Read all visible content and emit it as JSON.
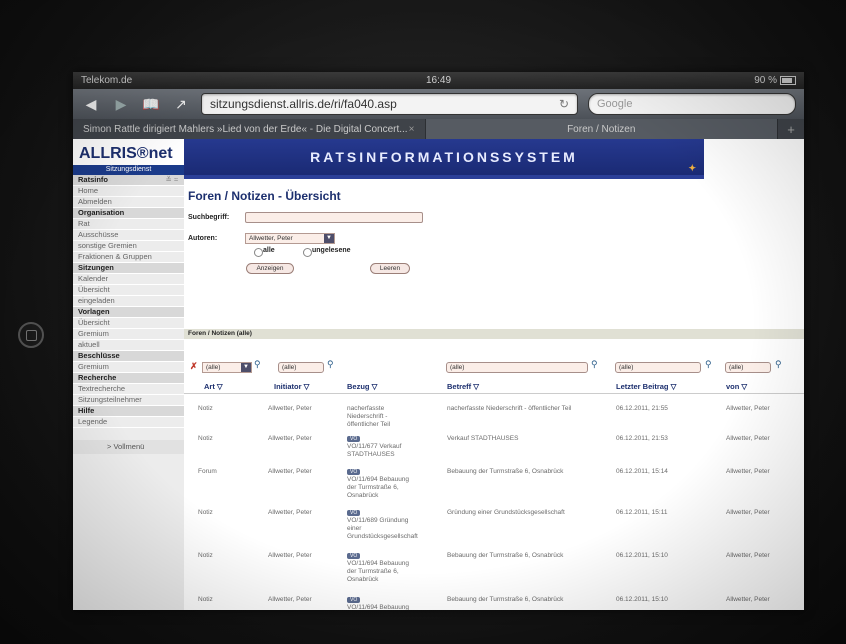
{
  "statusbar": {
    "carrier": "Telekom.de",
    "time": "16:49",
    "battery": "90 %"
  },
  "browser": {
    "url": "sitzungsdienst.allris.de/ri/fa040.asp",
    "search_placeholder": "Google",
    "tabs": [
      {
        "label": "Simon Rattle dirigiert Mahlers »Lied von der Erde« - Die Digital Concert..."
      },
      {
        "label": "Foren / Notizen"
      }
    ]
  },
  "site": {
    "logo": "ALLRIS®net",
    "logo_sub": "Sitzungsdienst",
    "banner": "RATSINFORMATIONSSYSTEM"
  },
  "sidebar": [
    {
      "type": "head",
      "label": "Ratsinfo"
    },
    {
      "type": "item",
      "label": "Home"
    },
    {
      "type": "item",
      "label": "Abmelden"
    },
    {
      "type": "head",
      "label": "Organisation"
    },
    {
      "type": "item",
      "label": "Rat"
    },
    {
      "type": "item",
      "label": "Ausschüsse"
    },
    {
      "type": "item",
      "label": "sonstige Gremien"
    },
    {
      "type": "item",
      "label": "Fraktionen & Gruppen"
    },
    {
      "type": "head",
      "label": "Sitzungen"
    },
    {
      "type": "item",
      "label": "Kalender"
    },
    {
      "type": "item",
      "label": "Übersicht"
    },
    {
      "type": "item",
      "label": "eingeladen"
    },
    {
      "type": "head",
      "label": "Vorlagen"
    },
    {
      "type": "item",
      "label": "Übersicht"
    },
    {
      "type": "item",
      "label": "Gremium"
    },
    {
      "type": "item",
      "label": "aktuell"
    },
    {
      "type": "head",
      "label": "Beschlüsse"
    },
    {
      "type": "item",
      "label": "Gremium"
    },
    {
      "type": "head",
      "label": "Recherche"
    },
    {
      "type": "item",
      "label": "Textrecherche"
    },
    {
      "type": "item",
      "label": "Sitzungsteilnehmer"
    },
    {
      "type": "head",
      "label": "Hilfe"
    },
    {
      "type": "item",
      "label": "Legende"
    }
  ],
  "sidebar_full_menu": "> Vollmenü",
  "main": {
    "title": "Foren / Notizen - Übersicht",
    "search_label": "Suchbegriff:",
    "search_value": "",
    "authors_label": "Autoren:",
    "authors_selected": "Allwetter, Peter",
    "radio_all": "alle",
    "radio_unread": "ungelesene",
    "show_button": "Anzeigen",
    "clear_button": "Leeren",
    "section_title": "Foren / Notizen (alle)",
    "filter_all": "(alle)",
    "columns": [
      "Art ▽",
      "Initiator ▽",
      "Bezug ▽",
      "Betreff ▽",
      "Letzter Beitrag ▽",
      "von ▽"
    ]
  },
  "rows": [
    {
      "art": "Notiz",
      "initiator": "Allwetter, Peter",
      "bezug_vo": "",
      "bezug": "nacherfasste Niederschrift - öffentlicher Teil",
      "betreff": "nacherfasste Niederschrift - öffentlicher Teil",
      "datum": "06.12.2011, 21:55",
      "von": "Allwetter, Peter"
    },
    {
      "art": "Notiz",
      "initiator": "Allwetter, Peter",
      "bezug_vo": "VO",
      "bezug": "VO/11/677 Verkauf STADTHAUSES",
      "betreff": "Verkauf STADTHAUSES",
      "datum": "06.12.2011, 21:53",
      "von": "Allwetter, Peter"
    },
    {
      "art": "Forum",
      "initiator": "Allwetter, Peter",
      "bezug_vo": "VO",
      "bezug": "VO/11/694 Bebauung der Turmstraße 6, Osnabrück",
      "betreff": "Bebauung der Turmstraße 6, Osnabrück",
      "datum": "06.12.2011, 15:14",
      "von": "Allwetter, Peter"
    },
    {
      "art": "Notiz",
      "initiator": "Allwetter, Peter",
      "bezug_vo": "VO",
      "bezug": "VO/11/689 Gründung einer Grundstücksgesellschaft",
      "betreff": "Gründung einer Grundstücksgesellschaft",
      "datum": "06.12.2011, 15:11",
      "von": "Allwetter, Peter"
    },
    {
      "art": "Notiz",
      "initiator": "Allwetter, Peter",
      "bezug_vo": "VO",
      "bezug": "VO/11/694 Bebauung der Turmstraße 6, Osnabrück",
      "betreff": "Bebauung der Turmstraße 6, Osnabrück",
      "datum": "06.12.2011, 15:10",
      "von": "Allwetter, Peter"
    },
    {
      "art": "Notiz",
      "initiator": "Allwetter, Peter",
      "bezug_vo": "VO",
      "bezug": "VO/11/694 Bebauung",
      "betreff": "Bebauung der Turmstraße 6, Osnabrück",
      "datum": "06.12.2011, 15:10",
      "von": "Allwetter, Peter"
    }
  ]
}
